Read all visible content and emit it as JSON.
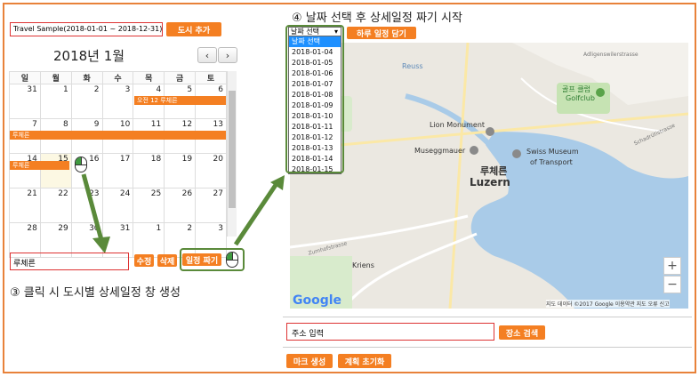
{
  "trip": {
    "selected": "Travel Sample(2018-01-01 ~ 2018-12-31)",
    "add_city_label": "도시 추가"
  },
  "calendar": {
    "title": "2018년 1월",
    "prev": "‹",
    "next": "›",
    "weekdays": [
      "일",
      "월",
      "화",
      "수",
      "목",
      "금",
      "토"
    ],
    "weeks": [
      [
        "31",
        "1",
        "2",
        "3",
        "4",
        "5",
        "6"
      ],
      [
        "7",
        "8",
        "9",
        "10",
        "11",
        "12",
        "13"
      ],
      [
        "14",
        "15",
        "16",
        "17",
        "18",
        "19",
        "20"
      ],
      [
        "21",
        "22",
        "23",
        "24",
        "25",
        "26",
        "27"
      ],
      [
        "28",
        "29",
        "30",
        "31",
        "1",
        "2",
        "3"
      ]
    ],
    "events": {
      "e1": "오전 12 루체른",
      "e2": "루체른",
      "e3": "루체른"
    }
  },
  "city_panel": {
    "city_value": "루체른",
    "edit_label": "수정",
    "delete_label": "삭제",
    "plan_label": "일정 짜기"
  },
  "captions": {
    "step3": "③ 클릭 시 도시별 상세일정 창 생성",
    "step4": "④ 날짜 선택 후 상세일정 짜기 시작"
  },
  "day_plan": {
    "select_label": "날짜 선택",
    "options": [
      "날짜 선택",
      "2018-01-04",
      "2018-01-05",
      "2018-01-06",
      "2018-01-07",
      "2018-01-08",
      "2018-01-09",
      "2018-01-10",
      "2018-01-11",
      "2018-01-12",
      "2018-01-13",
      "2018-01-14",
      "2018-01-15"
    ],
    "add_day_label": "하루 일정 담기"
  },
  "map": {
    "labels": {
      "lion": "Lion Monument",
      "museggmauer": "Museggmauer",
      "golf_kr": "골프 클럽",
      "golf_en": "Golfclub",
      "transport_1": "Swiss Museum",
      "transport_2": "of Transport",
      "city_kr": "루체른",
      "city_en": "Luzern",
      "reuss": "Reuss",
      "kriens": "Kriens",
      "adligenswil": "Adligenswilerstrasse",
      "zumhofstrasse": "Zumhofstrasse",
      "schadrustrasse": "Schadrütistrasse"
    },
    "google": "Google",
    "attribution": "지도 데이터 ©2017 Google  이용약관  지도 오류 신고",
    "zoom_in": "+",
    "zoom_out": "−"
  },
  "search": {
    "address_value": "주소 입력",
    "search_label": "장소 검색"
  },
  "bottom": {
    "make_marks_label": "마크 생성",
    "reset_plan_label": "계획 초기화"
  },
  "colors": {
    "accent": "#f47f22",
    "annotation_green": "#5a8a3a",
    "input_border": "#dd3333"
  }
}
